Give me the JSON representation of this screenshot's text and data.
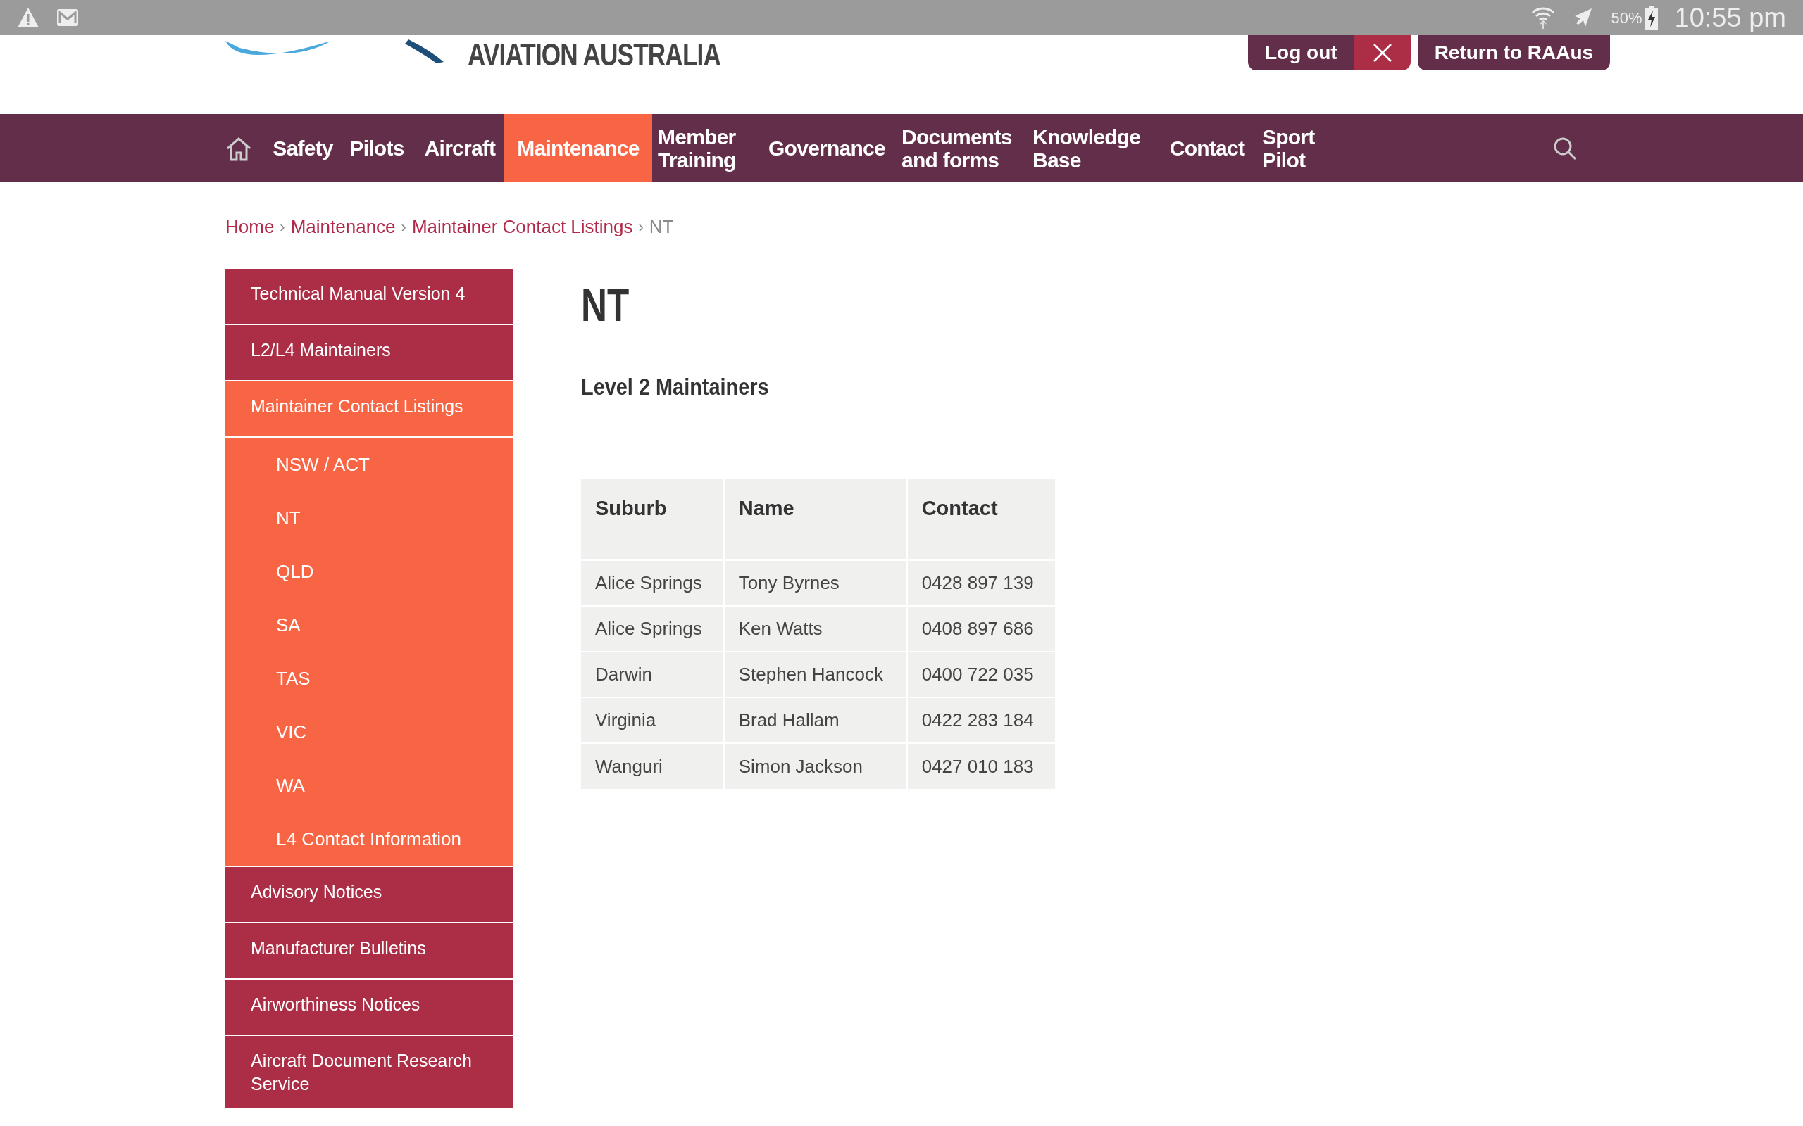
{
  "status_bar": {
    "battery": "50%",
    "time": "10:55 pm"
  },
  "header": {
    "logo_text": "AVIATION AUSTRALIA",
    "logout": "Log out",
    "return": "Return to RAAus"
  },
  "nav": [
    {
      "label": "Safety",
      "selected": false
    },
    {
      "label": "Pilots",
      "selected": false
    },
    {
      "label": "Aircraft",
      "selected": false
    },
    {
      "label": "Maintenance",
      "selected": true
    },
    {
      "label": "Member Training",
      "selected": false
    },
    {
      "label": "Governance",
      "selected": false
    },
    {
      "label": "Documents and forms",
      "selected": false
    },
    {
      "label": "Knowledge Base",
      "selected": false
    },
    {
      "label": "Contact",
      "selected": false
    },
    {
      "label": "Sport Pilot",
      "selected": false
    }
  ],
  "breadcrumb": {
    "links": [
      "Home",
      "Maintenance",
      "Maintainer Contact Listings"
    ],
    "current": "NT",
    "separator": "›"
  },
  "sidebar": [
    {
      "label": "Technical Manual Version 4",
      "selected": false
    },
    {
      "label": "L2/L4 Maintainers",
      "selected": false
    },
    {
      "label": "Maintainer Contact Listings",
      "selected": true,
      "children": [
        {
          "label": "NSW / ACT"
        },
        {
          "label": "NT"
        },
        {
          "label": "QLD"
        },
        {
          "label": "SA"
        },
        {
          "label": "TAS"
        },
        {
          "label": "VIC"
        },
        {
          "label": "WA"
        },
        {
          "label": "L4 Contact Information"
        }
      ]
    },
    {
      "label": "Advisory Notices",
      "selected": false
    },
    {
      "label": "Manufacturer Bulletins",
      "selected": false
    },
    {
      "label": "Airworthiness Notices",
      "selected": false
    },
    {
      "label": "Aircraft Document Research Service",
      "selected": false
    }
  ],
  "title": "NT",
  "subtitle": "Level 2 Maintainers",
  "table": {
    "columns": [
      "Suburb",
      "Name",
      "Contact"
    ],
    "rows": [
      [
        "Alice Springs",
        "Tony Byrnes",
        "0428 897 139"
      ],
      [
        "Alice Springs",
        "Ken Watts",
        "0408 897 686"
      ],
      [
        "Darwin",
        "Stephen Hancock",
        "0400 722 035"
      ],
      [
        "Virginia",
        "Brad Hallam",
        "0422 283 184"
      ],
      [
        "Wanguri",
        "Simon Jackson",
        "0427 010 183"
      ]
    ]
  }
}
